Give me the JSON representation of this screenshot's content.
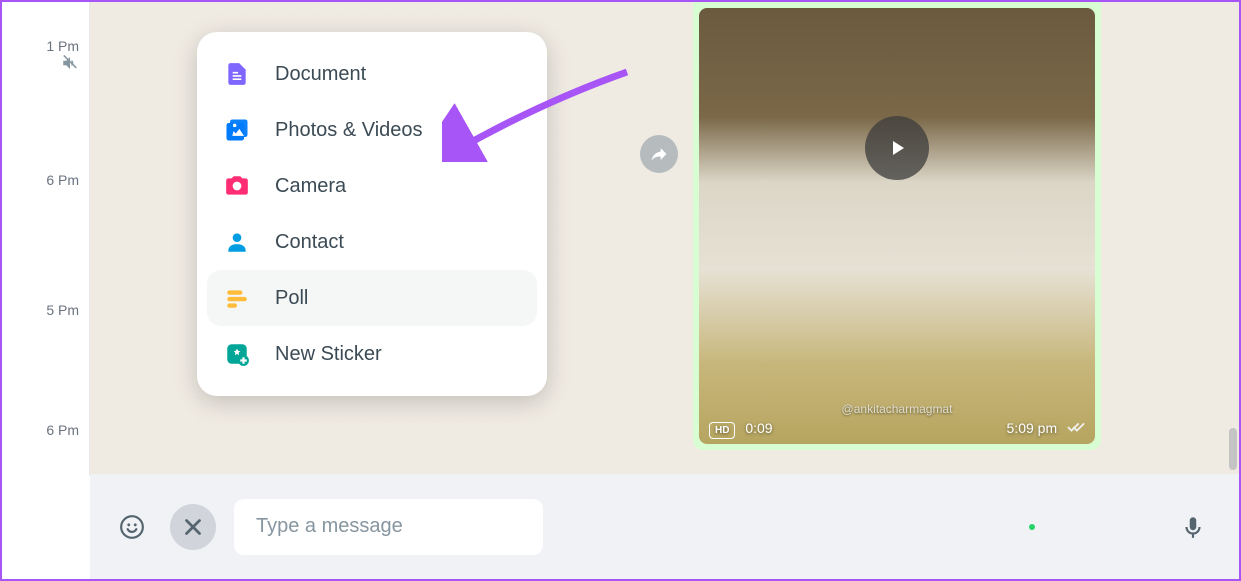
{
  "sidebar": {
    "items": [
      {
        "time": "1 Pm",
        "muted": true
      },
      {
        "time": "6 Pm"
      },
      {
        "time": "5 Pm"
      },
      {
        "time": "6 Pm"
      }
    ]
  },
  "attachment_menu": {
    "items": [
      {
        "label": "Document",
        "icon": "document-icon",
        "color": "#7f66ff"
      },
      {
        "label": "Photos & Videos",
        "icon": "photos-videos-icon",
        "color": "#007bfc"
      },
      {
        "label": "Camera",
        "icon": "camera-icon",
        "color": "#ff2e74"
      },
      {
        "label": "Contact",
        "icon": "contact-icon",
        "color": "#009de2"
      },
      {
        "label": "Poll",
        "icon": "poll-icon",
        "color": "#ffbc38",
        "hovered": true
      },
      {
        "label": "New Sticker",
        "icon": "new-sticker-icon",
        "color": "#02a698"
      }
    ]
  },
  "annotation": {
    "arrow_color": "#a855f7",
    "target": "Photos & Videos"
  },
  "message": {
    "type": "video",
    "hd": "HD",
    "duration": "0:09",
    "sent_at": "5:09 pm",
    "status": "read",
    "handle": "@ankitacharmagmat"
  },
  "composer": {
    "placeholder": "Type a message",
    "value": ""
  }
}
